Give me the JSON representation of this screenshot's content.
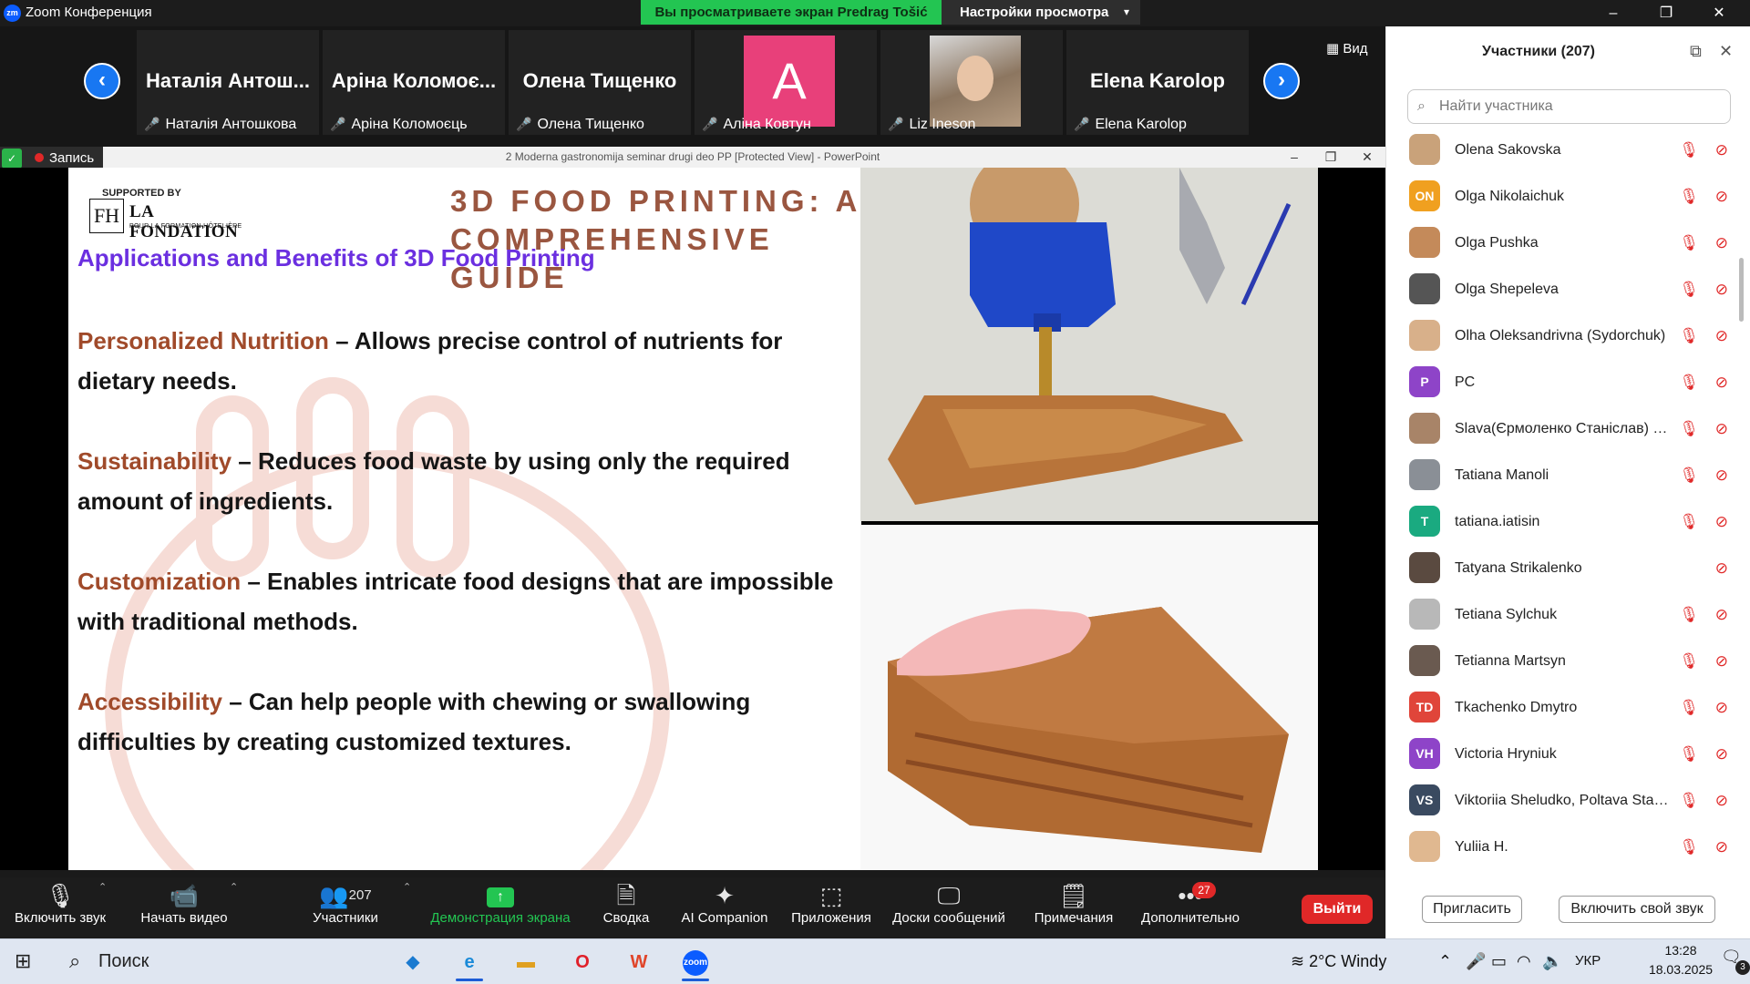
{
  "app": {
    "title": "Zoom Конференция"
  },
  "share_banner": {
    "text": "Вы просматриваете экран Predrag Tošić",
    "view_options": "Настройки просмотра"
  },
  "window_controls": {
    "minimize": "–",
    "restore": "❐",
    "close": "✕"
  },
  "gallery": {
    "view_label": "Вид",
    "tiles": [
      {
        "display": "Наталія Антош...",
        "name": "Наталія Антошкова"
      },
      {
        "display": "Аріна Коломоє...",
        "name": "Аріна Коломоєць"
      },
      {
        "display": "Олена Тищенко",
        "name": "Олена Тищенко"
      },
      {
        "display": "A",
        "name": "Аліна Ковтун"
      },
      {
        "display": "",
        "name": "Liz Ineson"
      },
      {
        "display": "Elena Karolop",
        "name": "Elena Karolop"
      }
    ]
  },
  "recording": {
    "label": "Запись"
  },
  "ppt": {
    "window_title": "2 Moderna gastronomija seminar drugi deo PP [Protected View] - PowerPoint"
  },
  "slide": {
    "supported_by": "SUPPORTED BY",
    "logo_fh": "FH",
    "logo_name": "LA FONDATION",
    "logo_sub": "POUR LA FORMATION HÔTELIÈRE",
    "title": "3D FOOD PRINTING: A COMPREHENSIVE GUIDE",
    "subtitle": "Applications and Benefits of 3D Food Printing",
    "bullets": [
      {
        "key": "Personalized Nutrition",
        "text": " – Allows precise control of nutrients for dietary needs."
      },
      {
        "key": "Sustainability",
        "text": " – Reduces food waste by using only the required amount of ingredients."
      },
      {
        "key": "Customization",
        "text": " – Enables intricate food designs that are impossible with traditional methods."
      },
      {
        "key": "Accessibility",
        "text": " – Can help people with chewing or swallowing difficulties by creating customized textures."
      }
    ]
  },
  "toolbar": {
    "unmute": "Включить звук",
    "start_video": "Начать видео",
    "participants": "Участники",
    "participants_count": "207",
    "share": "Демонстрация экрана",
    "summary": "Сводка",
    "ai": "AI Companion",
    "apps": "Приложения",
    "boards": "Доски сообщений",
    "notes": "Примечания",
    "more": "Дополнительно",
    "more_badge": "27",
    "leave": "Выйти"
  },
  "panel": {
    "title": "Участники (207)",
    "search_placeholder": "Найти участника",
    "participants": [
      {
        "initials": "",
        "name": "Olena Sakovska",
        "color": "#c9a27a"
      },
      {
        "initials": "ON",
        "name": "Olga Nikolaichuk",
        "color": "#f0a020"
      },
      {
        "initials": "",
        "name": "Olga Pushka",
        "color": "#c48a5a"
      },
      {
        "initials": "",
        "name": "Olga Shepeleva",
        "color": "#555555"
      },
      {
        "initials": "",
        "name": "Olha Oleksandrivna (Sydorchuk)",
        "color": "#d8b08a"
      },
      {
        "initials": "P",
        "name": "PC",
        "color": "#8e44c8"
      },
      {
        "initials": "",
        "name": "Slava(Єрмоленко Станіслав) 18...",
        "color": "#a88468"
      },
      {
        "initials": "",
        "name": "Tatiana Manoli",
        "color": "#8a8f96"
      },
      {
        "initials": "T",
        "name": "tatiana.iatisin",
        "color": "#1aaa80"
      },
      {
        "initials": "",
        "name": "Tatyana Strikalenko",
        "color": "#5a4a40"
      },
      {
        "initials": "",
        "name": "Tetiana Sylchuk",
        "color": "#b8b8b8"
      },
      {
        "initials": "",
        "name": "Tetianna Martsyn",
        "color": "#6a5a50"
      },
      {
        "initials": "TD",
        "name": "Tkachenko Dmytro",
        "color": "#e0453a"
      },
      {
        "initials": "VH",
        "name": "Victoria Hryniuk",
        "color": "#8e44c8"
      },
      {
        "initials": "VS",
        "name": "Viktoriia Sheludko, Poltava State ...",
        "color": "#3a4a60"
      },
      {
        "initials": "",
        "name": "Yuliia H.",
        "color": "#e0b890"
      }
    ],
    "invite": "Пригласить",
    "unmute_me": "Включить свой звук"
  },
  "taskbar": {
    "search": "Поиск",
    "weather": "2°C  Windy",
    "lang": "УКР",
    "time": "13:28",
    "date": "18.03.2025",
    "notif_count": "3"
  },
  "colors": {
    "zoom_blue": "#0b5cff",
    "share_green": "#23c552",
    "leave_red": "#e02828"
  }
}
